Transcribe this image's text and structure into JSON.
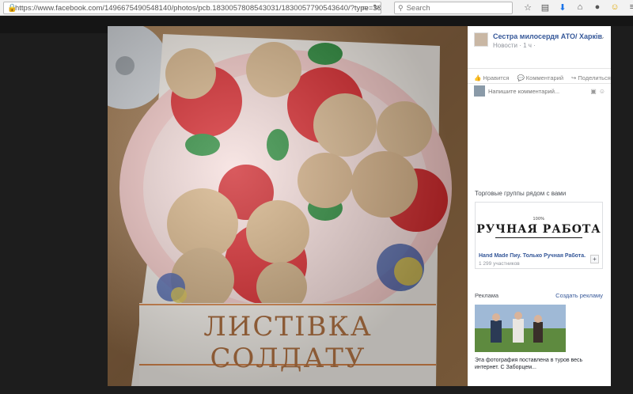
{
  "browser": {
    "url": "https://www.facebook.com/1496675490548140/photos/pcb.1830057808543031/1830057790543640/?type=3&theater",
    "search_placeholder": "Search",
    "icons": [
      "star-icon",
      "reading-list-icon",
      "download-icon",
      "home-icon",
      "extension-icon",
      "emoji-icon",
      "menu-icon"
    ]
  },
  "viewer": {
    "photo_caption_art": "ЛИСТІВКА СОЛДАТУ"
  },
  "sidebar": {
    "page_name": "Сестра милосердя АТО/ Харків",
    "page_meta": "Новости · 1 ч ·",
    "actions": [
      {
        "icon": "like-icon",
        "label": "Нравится"
      },
      {
        "icon": "comment-icon",
        "label": "Комментарий"
      },
      {
        "icon": "share-icon",
        "label": "Поделиться"
      }
    ],
    "comment_placeholder": "Напишите комментарий...",
    "groups_title": "Торговые группы рядом с вами",
    "group": {
      "banner_small": "100%",
      "banner_title": "РУЧНАЯ РАБОТА",
      "name": "Hand Made Пиу. Только Ручная Работа.",
      "count": "1 299 участников",
      "join": "+"
    },
    "ads": {
      "label": "Реклама",
      "create": "Создать рекламу",
      "text": "Эта фотография поставлена в туров весь интернет. С Заборцем..."
    }
  }
}
